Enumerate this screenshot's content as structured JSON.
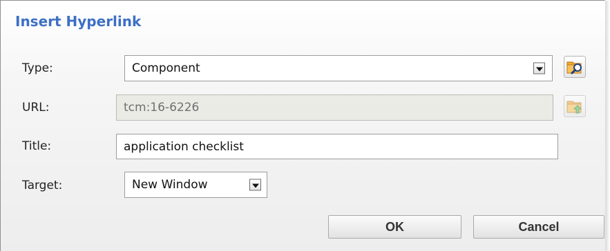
{
  "dialog": {
    "title": "Insert Hyperlink"
  },
  "form": {
    "type_label": "Type:",
    "type_value": "Component",
    "url_label": "URL:",
    "url_value": "tcm:16-6226",
    "title_label": "Title:",
    "title_value": "application checklist",
    "target_label": "Target:",
    "target_value": "New Window"
  },
  "icons": {
    "browse": "folder-search-icon",
    "upload": "folder-upload-icon",
    "dropdown": "chevron-down-icon"
  },
  "buttons": {
    "ok": "OK",
    "cancel": "Cancel"
  },
  "colors": {
    "title": "#3d6fc5",
    "folder": "#f0a934",
    "disabled_field": "#ebebe6"
  }
}
